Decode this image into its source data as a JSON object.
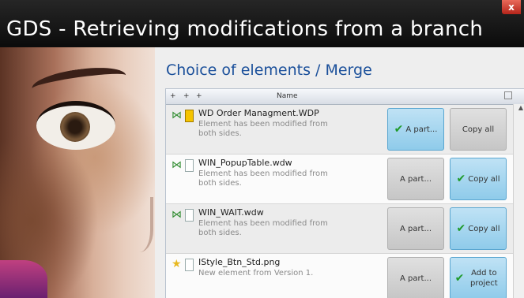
{
  "window": {
    "title": "GDS - Retrieving modifications from a branch",
    "close_label": "x"
  },
  "section": {
    "heading": "Choice of elements / Merge"
  },
  "grid": {
    "columns": [
      "Name"
    ],
    "header_arrows": [
      "+",
      "+",
      "+"
    ],
    "rows": [
      {
        "name": "WD Order Managment.WDP",
        "description": "Element has been modified from both sides.",
        "sel_icon": "merge-icon",
        "status_icon": "warning-icon",
        "btn1": {
          "label": "A part...",
          "selected": true
        },
        "btn2": {
          "label": "Copy all",
          "selected": false
        }
      },
      {
        "name": "WIN_PopupTable.wdw",
        "description": "Element has been modified from both sides.",
        "sel_icon": "merge-icon",
        "status_icon": "document-icon",
        "btn1": {
          "label": "A part...",
          "selected": false
        },
        "btn2": {
          "label": "Copy all",
          "selected": true
        }
      },
      {
        "name": "WIN_WAIT.wdw",
        "description": "Element has been modified from both sides.",
        "sel_icon": "merge-icon",
        "status_icon": "document-icon",
        "btn1": {
          "label": "A part...",
          "selected": false
        },
        "btn2": {
          "label": "Copy all",
          "selected": true
        }
      },
      {
        "name": "IStyle_Btn_Std.png",
        "description": "New element from Version 1.",
        "sel_icon": "star-icon",
        "status_icon": "document-icon",
        "btn1": {
          "label": "A part...",
          "selected": false
        },
        "btn2": {
          "label": "Add to project",
          "selected": true
        }
      }
    ]
  },
  "colors": {
    "heading": "#1a4f9a",
    "selected_button": "#8fcbea",
    "check": "#1f9a2a"
  }
}
